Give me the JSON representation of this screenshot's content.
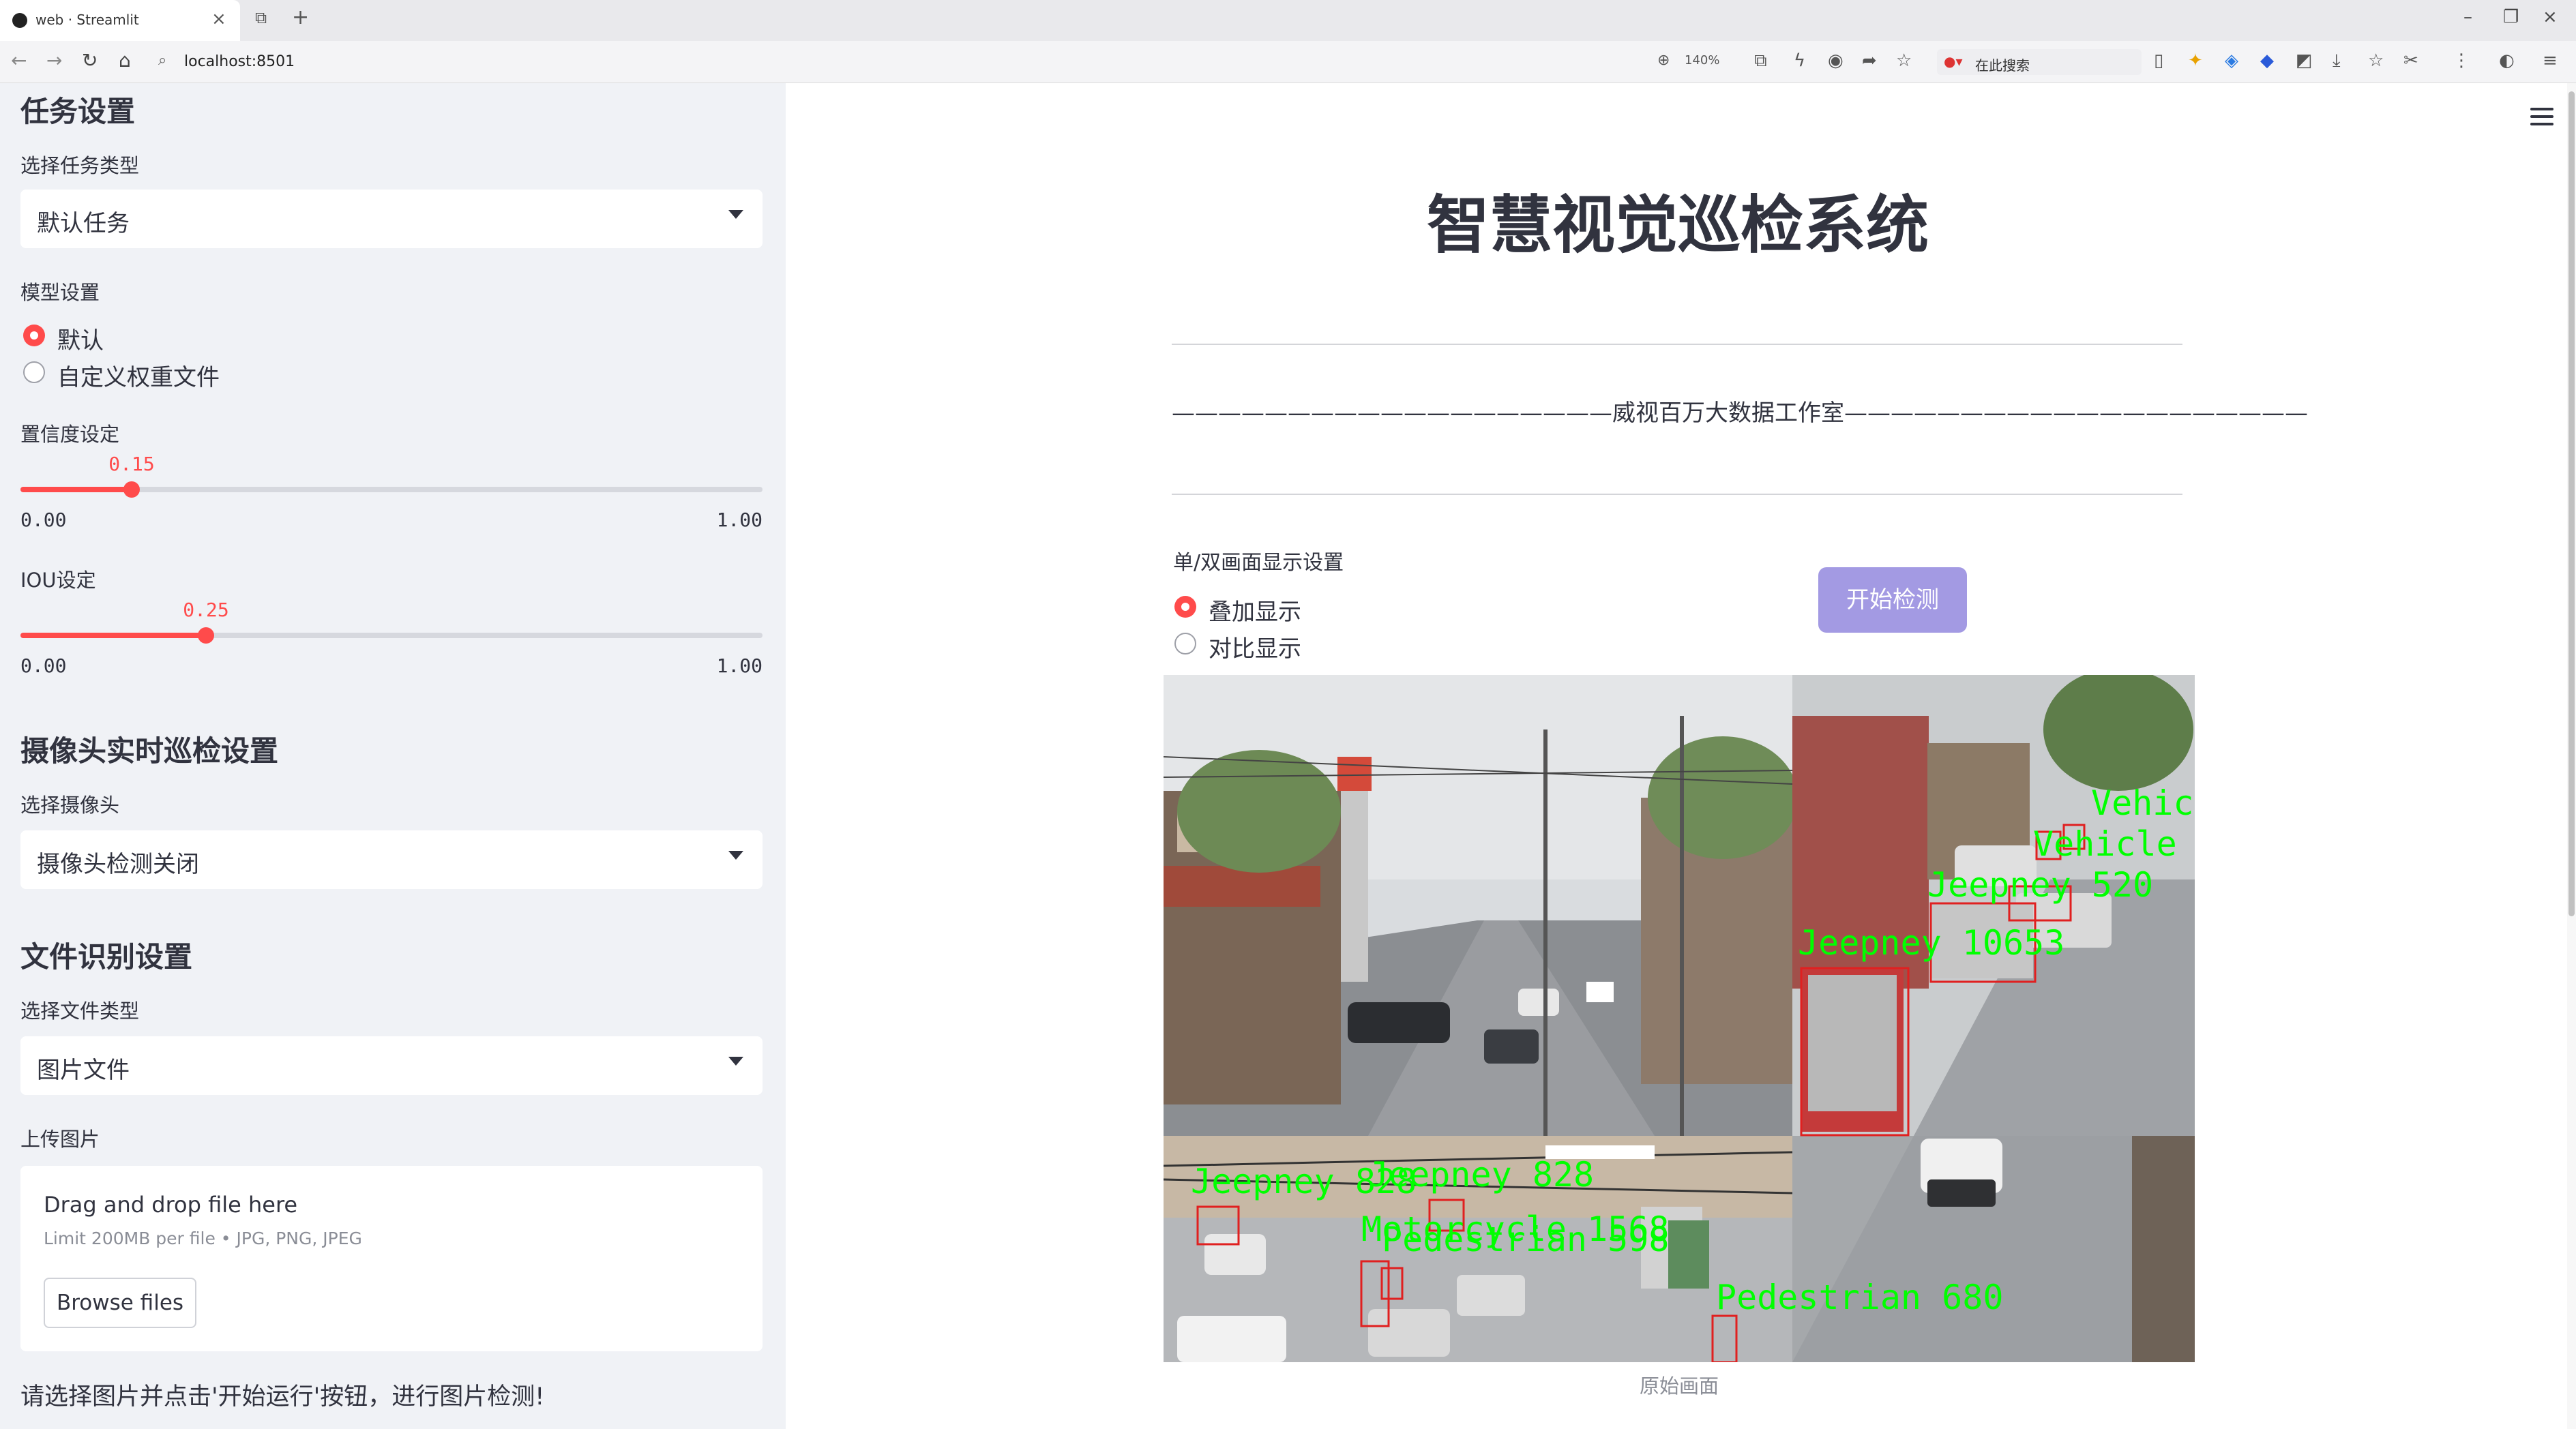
{
  "browser": {
    "tab_title": "web · Streamlit",
    "url": "localhost:8501",
    "zoom": "140%",
    "search_placeholder": "在此搜索"
  },
  "sidebar": {
    "task_section_title": "任务设置",
    "task_type_label": "选择任务类型",
    "task_type_value": "默认任务",
    "model_label": "模型设置",
    "model_options": [
      "默认",
      "自定义权重文件"
    ],
    "model_selected": "默认",
    "confidence": {
      "label": "置信度设定",
      "value": "0.15",
      "min": "0.00",
      "max": "1.00",
      "fraction": 0.15
    },
    "iou": {
      "label": "IOU设定",
      "value": "0.25",
      "min": "0.00",
      "max": "1.00",
      "fraction": 0.25
    },
    "camera_section_title": "摄像头实时巡检设置",
    "camera_label": "选择摄像头",
    "camera_value": "摄像头检测关闭",
    "file_section_title": "文件识别设置",
    "file_type_label": "选择文件类型",
    "file_type_value": "图片文件",
    "upload_label": "上传图片",
    "upload": {
      "drag_text": "Drag and drop file here",
      "limit_text": "Limit 200MB per file • JPG, PNG, JPEG",
      "browse_label": "Browse files"
    },
    "note": "请选择图片并点击'开始运行'按钮，进行图片检测!"
  },
  "main": {
    "title": "智慧视觉巡检系统",
    "studio_line": "———————————————————威视百万大数据工作室————————————————————",
    "display_label": "单/双画面显示设置",
    "display_options": [
      "叠加显示",
      "对比显示"
    ],
    "display_selected": "叠加显示",
    "start_button": "开始检测",
    "image_caption": "原始画面",
    "detections": [
      "Jeepney 10653",
      "Jeepney 520",
      "Vehicle",
      "Vehicle",
      "Jeepney 828",
      "Jeepney 828",
      "Motorcycle 1568",
      "Pedestrian 598",
      "Pedestrian 680"
    ]
  },
  "colors": {
    "accent": "#ff4b4b",
    "sidebar_bg": "#f0f2f6",
    "button_bg": "#a39ae3",
    "detection_text": "#00ff00",
    "detection_box": "#e02020"
  }
}
